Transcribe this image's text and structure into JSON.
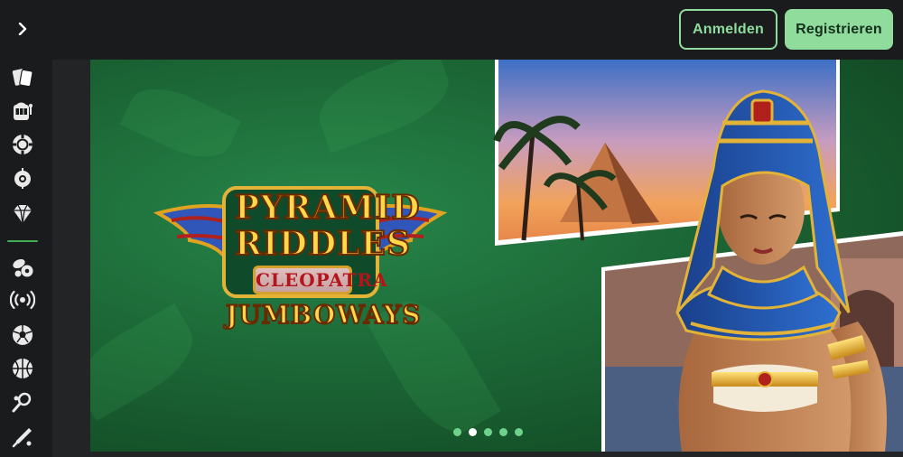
{
  "header": {
    "login_label": "Anmelden",
    "register_label": "Registrieren"
  },
  "banner": {
    "logo_line1": "PYRAMID",
    "logo_line2": "RIDDLES",
    "logo_line3": "CLEOPATRA",
    "logo_line4": "JUMBOWAYS",
    "slide_count": 5,
    "active_slide_index": 1
  },
  "colors": {
    "accent": "#8fdc9c",
    "background": "#1a1b1d",
    "banner_green": "#1d6a38"
  },
  "sidebar_icons": [
    "cards-icon",
    "slot-machine-icon",
    "casino-chip-icon",
    "roulette-icon",
    "diamond-icon",
    "sports-balls-icon",
    "live-broadcast-icon",
    "soccer-ball-icon",
    "basketball-icon",
    "tennis-icon",
    "cricket-icon"
  ]
}
